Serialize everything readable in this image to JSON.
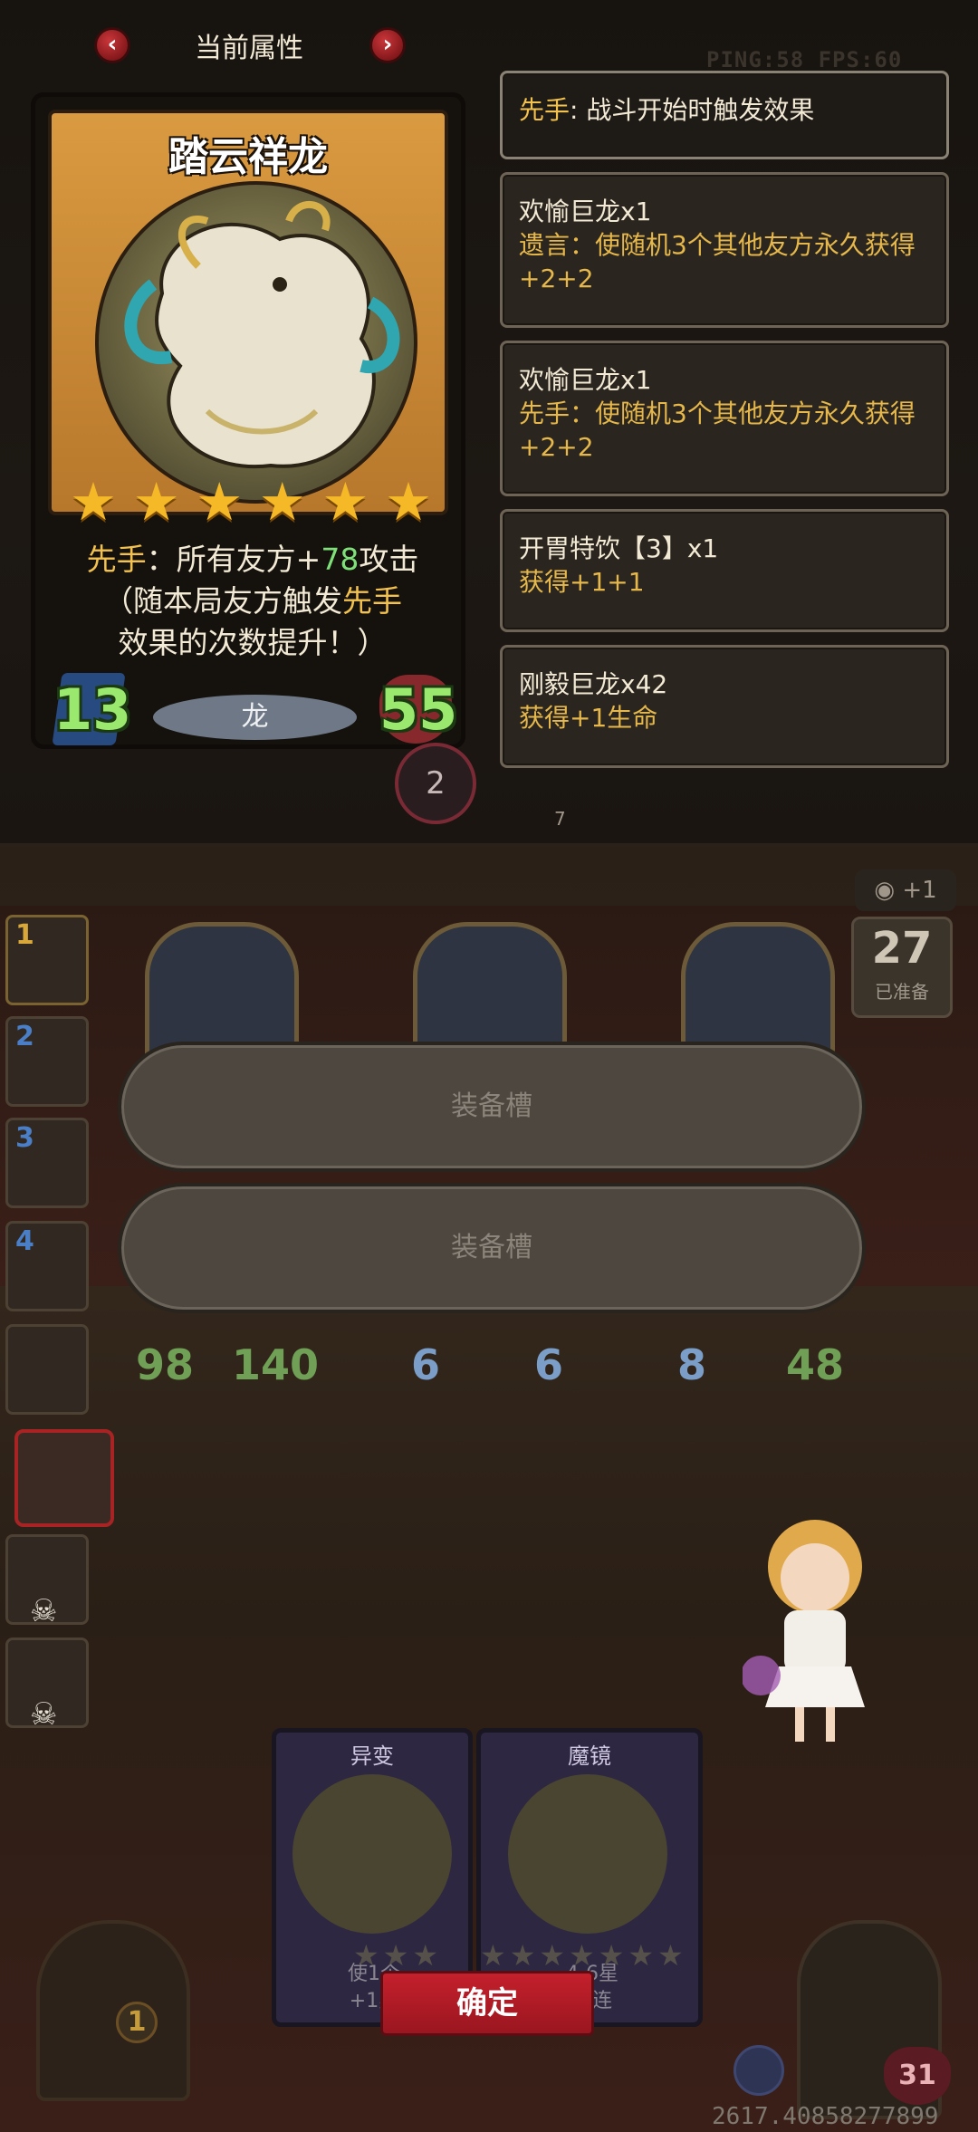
{
  "header": {
    "title": "当前属性",
    "prev_icon": "chevron-left-icon",
    "next_icon": "chevron-right-icon",
    "ping_fps": "PING:58 FPS:60"
  },
  "card": {
    "name": "踏云祥龙",
    "stars": 6,
    "desc_prefix": "先手",
    "desc_mid": "：所有友方+",
    "desc_value": "78",
    "desc_suffix": "攻击",
    "desc_line2_a": "（随本局友方触发",
    "desc_line2_b": "先手",
    "desc_line3": "效果的次数提升！）",
    "attack": "13",
    "health": "55",
    "tribe": "龙"
  },
  "effects": [
    {
      "label": "先手",
      "text": ": 战斗开始时触发效果"
    },
    {
      "line1": "欢愉巨龙x1",
      "line2": "遗言：使随机3个其他友方永久获得+2+2"
    },
    {
      "line1": "欢愉巨龙x1",
      "line2": "先手：使随机3个其他友方永久获得+2+2"
    },
    {
      "line1": "开胃特饮【3】x1",
      "line2": "获得+1+1"
    },
    {
      "line1": "刚毅巨龙x42",
      "line2": "获得+1生命"
    }
  ],
  "board": {
    "side_slots": [
      "1",
      "2",
      "3",
      "4"
    ],
    "ready_count": "27",
    "ready_label": "已准备",
    "eye_plus": "+1",
    "badge_small": "2",
    "badge_door": "7",
    "units": [
      {
        "atk": "98",
        "hp": "140"
      },
      {
        "atk": "6",
        "hp": "6"
      },
      {
        "atk": "8",
        "hp": "48"
      }
    ],
    "equip_slot_1": "装备槽",
    "equip_slot_2": "装备槽"
  },
  "bottom": {
    "card1_title": "异变",
    "card1_text": "使1个\n+1星",
    "card2_title": "魔镜",
    "card2_text": "4-6星\n三连",
    "confirm": "确定",
    "chest_count": "1",
    "heart_value": "31",
    "bottom_number": "2617.40858277899"
  },
  "colors": {
    "accent_red": "#c4202b",
    "star_gold": "#f5b928",
    "highlight_yellow": "#f2c14e",
    "stat_green": "#9be86f"
  }
}
